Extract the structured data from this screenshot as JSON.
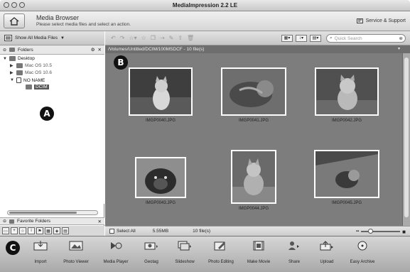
{
  "window": {
    "title": "MediaImpression 2.2 LE"
  },
  "header": {
    "title": "Media Browser",
    "subtitle": "Please select media files and select an action.",
    "service": "Service & Support"
  },
  "left_panel": {
    "show_all": "Show All Media Files",
    "folders_label": "Folders",
    "tree": [
      {
        "label": "Desktop"
      },
      {
        "label": "Mac OS 10.5"
      },
      {
        "label": "Mac OS 10.6"
      },
      {
        "label": "NO NAME"
      },
      {
        "label": "DCIM"
      }
    ],
    "favorites_label": "Favorite Folders"
  },
  "browser": {
    "path": "/Volumes/Untitled/DCIM/100MSDCF - 10 file(s)",
    "search_placeholder": "Quick Search",
    "thumbnails": [
      {
        "caption": "IMGP0040.JPG"
      },
      {
        "caption": "IMGP0041.JPG"
      },
      {
        "caption": "IMGP0042.JPG"
      },
      {
        "caption": "IMGP0043.JPG"
      },
      {
        "caption": "IMGP0044.JPG"
      },
      {
        "caption": "IMGP0045.JPG"
      }
    ]
  },
  "status": {
    "select_all": "Select All",
    "size": "5.55MB",
    "files": "10 file(s)"
  },
  "zoom_level": 0.2,
  "actions": [
    {
      "label": "Import",
      "icon": "import-icon"
    },
    {
      "label": "Photo Viewer",
      "icon": "photo-viewer-icon"
    },
    {
      "label": "Media Player",
      "icon": "media-player-icon"
    },
    {
      "label": "Geotag",
      "icon": "geotag-icon"
    },
    {
      "label": "Slideshow",
      "icon": "slideshow-icon"
    },
    {
      "label": "Photo Editing",
      "icon": "photo-editing-icon"
    },
    {
      "label": "Make Movie",
      "icon": "make-movie-icon"
    },
    {
      "label": "Share",
      "icon": "share-icon"
    },
    {
      "label": "Upload",
      "icon": "upload-icon"
    },
    {
      "label": "Easy Archive",
      "icon": "easy-archive-icon"
    }
  ],
  "markers": {
    "a": "A",
    "b": "B",
    "c": "C"
  }
}
